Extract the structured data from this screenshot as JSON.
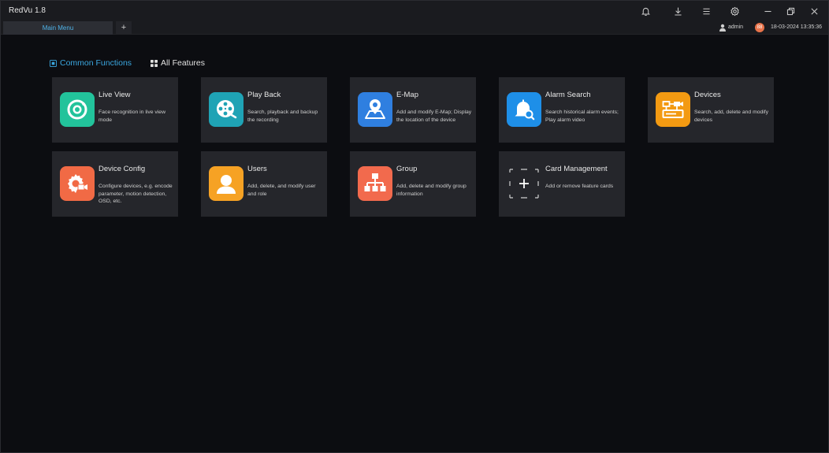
{
  "app": {
    "title": "RedVu 1.8"
  },
  "titlebar": {
    "icons": [
      "bell-icon",
      "download-icon",
      "menu-icon",
      "settings-icon",
      "minimize-icon",
      "restore-icon",
      "close-icon"
    ]
  },
  "tabs": {
    "main_label": "Main Menu",
    "add_label": "+"
  },
  "status": {
    "user": "admin",
    "alarm_count": "88",
    "datetime": "18-03-2024 13:35:36"
  },
  "function_tabs": {
    "common": "Common Functions",
    "all": "All Features"
  },
  "colors": {
    "accent": "#3ba7e0",
    "card_bg": "#25262b",
    "background": "#0c0d11"
  },
  "cards": [
    {
      "title": "Live View",
      "desc": "Face recognition in live view mode",
      "icon": "live-view-icon",
      "color": "#22c39b"
    },
    {
      "title": "Play Back",
      "desc": "Search, playback and backup the recording",
      "icon": "playback-icon",
      "color": "#1fa3b5"
    },
    {
      "title": "E-Map",
      "desc": "Add and modify E-Map; Display the location of the device",
      "icon": "emap-icon",
      "color": "#2f7fe0"
    },
    {
      "title": "Alarm Search",
      "desc": "Search historical alarm events; Play alarm video",
      "icon": "alarm-search-icon",
      "color": "#1e8fe8"
    },
    {
      "title": "Devices",
      "desc": "Search, add, delete and modify devices",
      "icon": "devices-icon",
      "color": "#f39a12"
    },
    {
      "title": "Device Config",
      "desc": "Configure devices, e.g. encode parameter, motion detection, OSD, etc.",
      "icon": "device-config-icon",
      "color": "#f16a45"
    },
    {
      "title": "Users",
      "desc": "Add, delete, and modify user and role",
      "icon": "users-icon",
      "color": "#f6a224"
    },
    {
      "title": "Group",
      "desc": "Add, delete and modify group information",
      "icon": "group-icon",
      "color": "#f26a4d"
    },
    {
      "title": "Card Management",
      "desc": "Add or remove feature cards",
      "icon": "add-card-icon",
      "color": ""
    }
  ]
}
